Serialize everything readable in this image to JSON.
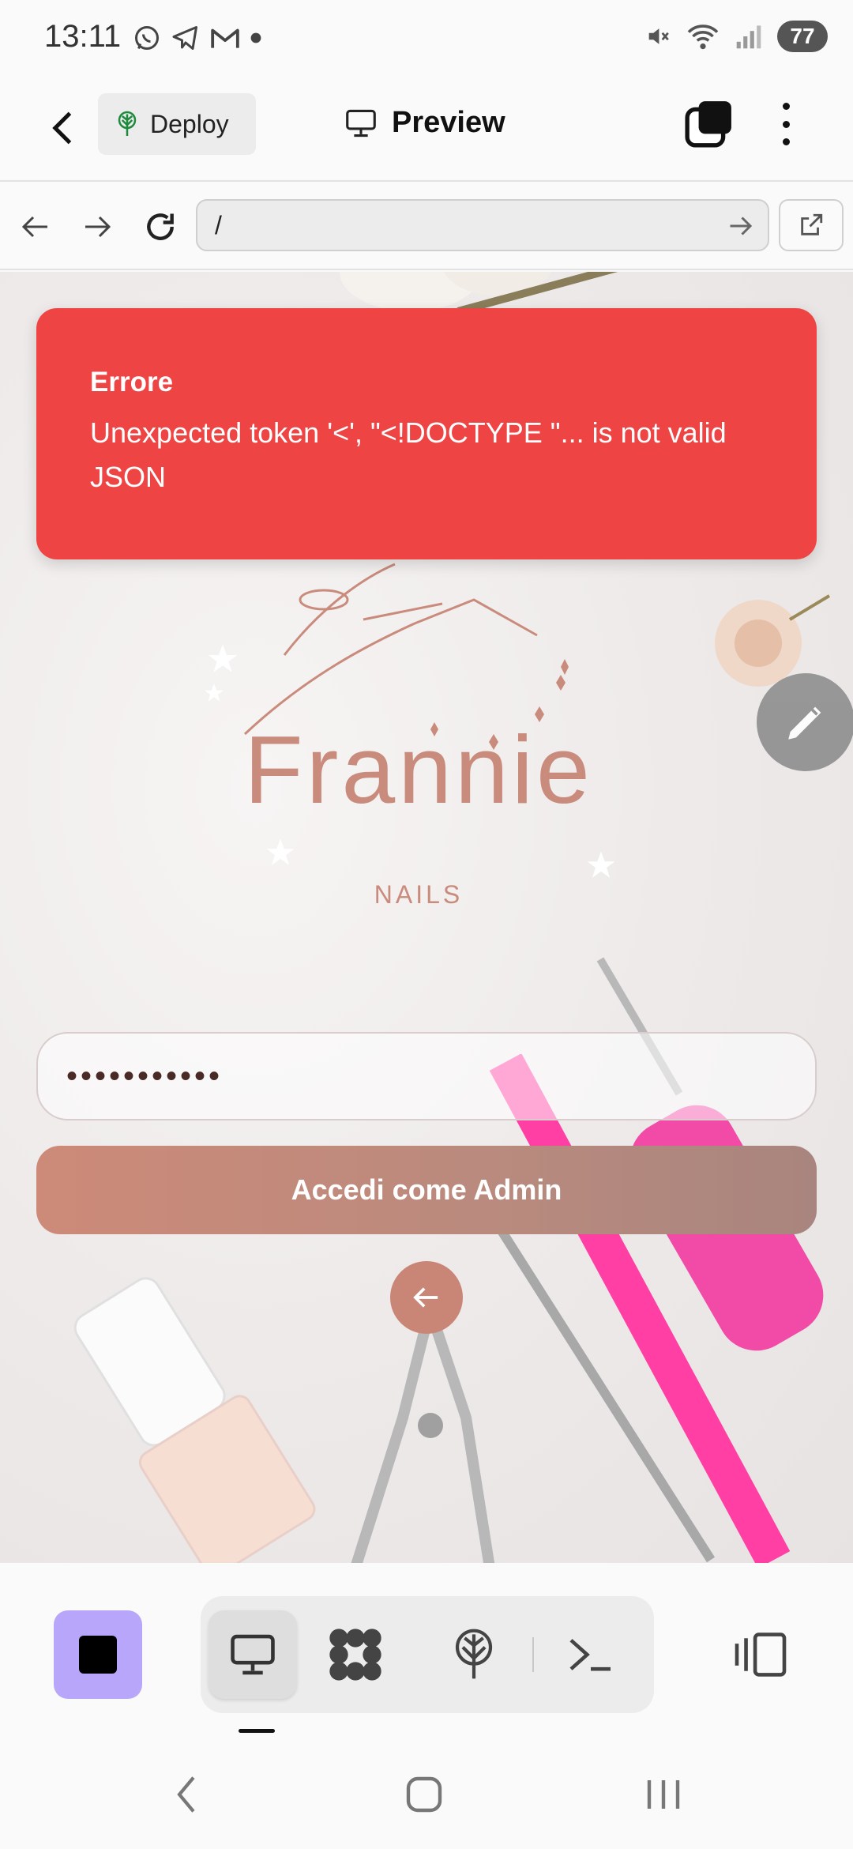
{
  "status_bar": {
    "time": "13:11",
    "battery": "77",
    "icons_left": [
      "whatsapp-icon",
      "telegram-icon",
      "gmail-icon",
      "dot-icon"
    ],
    "icons_right": [
      "mute-icon",
      "wifi-icon",
      "signal-icon"
    ]
  },
  "header": {
    "deploy_label": "Deploy",
    "preview_label": "Preview"
  },
  "browser": {
    "url": "/"
  },
  "error_toast": {
    "title": "Errore",
    "message": "Unexpected token '<', \"<!DOCTYPE \"... is not valid JSON"
  },
  "login": {
    "brand": "Frannie",
    "subtitle": "NAILS",
    "password_value": "•••••••••••",
    "admin_button": "Accedi come Admin"
  },
  "toolbar": {
    "modes": [
      "monitor-icon",
      "apps-grid-icon",
      "deploy-tree-icon",
      "terminal-icon"
    ],
    "active_mode": "monitor-icon"
  },
  "colors": {
    "error": "#ef4444",
    "accent": "#c98676",
    "stop_button": "#b8a6fb"
  }
}
